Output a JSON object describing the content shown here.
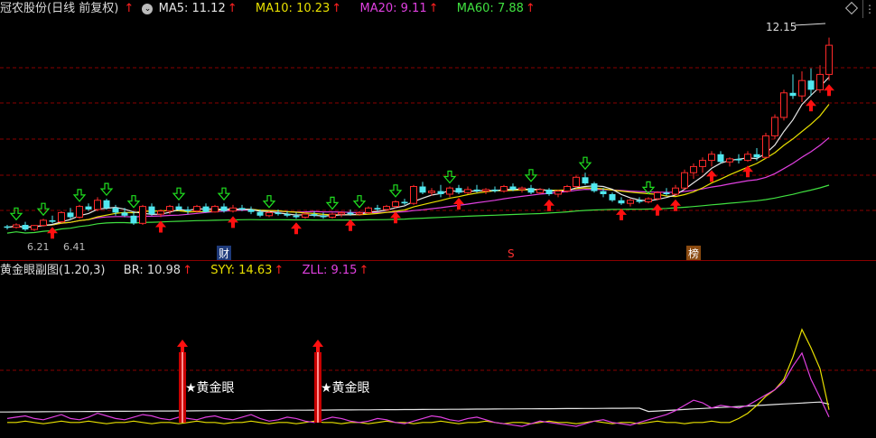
{
  "main_legend": {
    "title": "冠农股份(日线 前复权)",
    "ma5": "MA5: 11.12",
    "ma10": "MA10: 10.23",
    "ma20": "MA20: 9.11",
    "ma60": "MA60: 7.88"
  },
  "sub_legend": {
    "title": "黄金眼副图(1.20,3)",
    "br": "BR: 10.98",
    "syy": "SYY: 14.63",
    "zll": "ZLL: 9.15"
  },
  "colors": {
    "up_candle": "#ff2a2a",
    "down_candle": "#50e8f0",
    "ma5": "#e6e6e6",
    "ma10": "#e8e000",
    "ma20": "#e040e0",
    "ma60": "#40e040",
    "grid": "#8a0000",
    "buy_arrow": "#ff1010",
    "sell_arrow": "#20e020"
  },
  "chart_data": [
    {
      "type": "candlestick",
      "ylim": [
        5.8,
        12.8
      ],
      "grid": true,
      "series_names": [
        "MA5",
        "MA10",
        "MA20",
        "MA60"
      ],
      "candles": [
        [
          6.25,
          6.3,
          6.15,
          6.22
        ],
        [
          6.22,
          6.35,
          6.18,
          6.3
        ],
        [
          6.3,
          6.4,
          6.1,
          6.15
        ],
        [
          6.15,
          6.3,
          6.1,
          6.28
        ],
        [
          6.28,
          6.5,
          6.25,
          6.45
        ],
        [
          6.45,
          6.6,
          6.35,
          6.4
        ],
        [
          6.4,
          6.75,
          6.35,
          6.7
        ],
        [
          6.7,
          6.85,
          6.5,
          6.55
        ],
        [
          6.55,
          6.95,
          6.5,
          6.9
        ],
        [
          6.9,
          7.0,
          6.75,
          6.8
        ],
        [
          6.8,
          7.2,
          6.75,
          7.1
        ],
        [
          7.1,
          7.15,
          6.8,
          6.85
        ],
        [
          6.85,
          6.95,
          6.6,
          6.7
        ],
        [
          6.7,
          6.85,
          6.55,
          6.6
        ],
        [
          6.6,
          6.75,
          6.3,
          6.35
        ],
        [
          6.35,
          6.95,
          6.3,
          6.9
        ],
        [
          6.9,
          7.0,
          6.6,
          6.65
        ],
        [
          6.65,
          6.8,
          6.55,
          6.75
        ],
        [
          6.75,
          6.95,
          6.65,
          6.9
        ],
        [
          6.9,
          7.0,
          6.75,
          6.8
        ],
        [
          6.8,
          6.9,
          6.65,
          6.75
        ],
        [
          6.75,
          6.95,
          6.7,
          6.9
        ],
        [
          6.9,
          7.0,
          6.7,
          6.72
        ],
        [
          6.72,
          6.95,
          6.7,
          6.9
        ],
        [
          6.9,
          7.0,
          6.7,
          6.75
        ],
        [
          6.75,
          6.95,
          6.7,
          6.85
        ],
        [
          6.85,
          6.95,
          6.75,
          6.8
        ],
        [
          6.8,
          6.9,
          6.65,
          6.72
        ],
        [
          6.72,
          6.8,
          6.55,
          6.6
        ],
        [
          6.6,
          6.75,
          6.55,
          6.7
        ],
        [
          6.7,
          6.8,
          6.6,
          6.65
        ],
        [
          6.65,
          6.75,
          6.55,
          6.6
        ],
        [
          6.6,
          6.7,
          6.5,
          6.55
        ],
        [
          6.55,
          6.7,
          6.5,
          6.65
        ],
        [
          6.65,
          6.75,
          6.55,
          6.6
        ],
        [
          6.6,
          6.7,
          6.5,
          6.55
        ],
        [
          6.55,
          6.7,
          6.5,
          6.65
        ],
        [
          6.65,
          6.75,
          6.55,
          6.7
        ],
        [
          6.7,
          6.8,
          6.6,
          6.65
        ],
        [
          6.65,
          6.75,
          6.6,
          6.7
        ],
        [
          6.7,
          6.9,
          6.65,
          6.85
        ],
        [
          6.85,
          6.95,
          6.75,
          6.8
        ],
        [
          6.8,
          6.95,
          6.75,
          6.9
        ],
        [
          6.9,
          7.1,
          6.85,
          7.05
        ],
        [
          7.05,
          7.15,
          6.95,
          7.0
        ],
        [
          7.0,
          7.6,
          6.95,
          7.55
        ],
        [
          7.55,
          7.7,
          7.3,
          7.35
        ],
        [
          7.35,
          7.5,
          7.25,
          7.4
        ],
        [
          7.4,
          7.6,
          7.2,
          7.3
        ],
        [
          7.3,
          7.55,
          7.2,
          7.5
        ],
        [
          7.5,
          7.6,
          7.3,
          7.35
        ],
        [
          7.35,
          7.55,
          7.3,
          7.45
        ],
        [
          7.45,
          7.6,
          7.35,
          7.4
        ],
        [
          7.4,
          7.5,
          7.3,
          7.45
        ],
        [
          7.45,
          7.55,
          7.35,
          7.4
        ],
        [
          7.4,
          7.6,
          7.35,
          7.55
        ],
        [
          7.55,
          7.65,
          7.4,
          7.45
        ],
        [
          7.45,
          7.55,
          7.35,
          7.5
        ],
        [
          7.5,
          7.6,
          7.3,
          7.35
        ],
        [
          7.35,
          7.5,
          7.3,
          7.45
        ],
        [
          7.45,
          7.5,
          7.25,
          7.3
        ],
        [
          7.3,
          7.45,
          7.2,
          7.4
        ],
        [
          7.4,
          7.6,
          7.35,
          7.55
        ],
        [
          7.55,
          7.9,
          7.5,
          7.85
        ],
        [
          7.85,
          8.0,
          7.6,
          7.65
        ],
        [
          7.65,
          7.7,
          7.35,
          7.4
        ],
        [
          7.4,
          7.5,
          7.2,
          7.3
        ],
        [
          7.3,
          7.35,
          7.05,
          7.1
        ],
        [
          7.1,
          7.2,
          6.95,
          7.0
        ],
        [
          7.0,
          7.15,
          6.9,
          7.1
        ],
        [
          7.1,
          7.2,
          7.0,
          7.05
        ],
        [
          7.05,
          7.2,
          7.0,
          7.15
        ],
        [
          7.15,
          7.4,
          7.1,
          7.35
        ],
        [
          7.35,
          7.5,
          7.25,
          7.3
        ],
        [
          7.3,
          7.6,
          7.25,
          7.5
        ],
        [
          7.5,
          8.1,
          7.45,
          8.0
        ],
        [
          8.0,
          8.3,
          7.8,
          8.2
        ],
        [
          8.2,
          8.5,
          8.0,
          8.4
        ],
        [
          8.4,
          8.7,
          8.2,
          8.6
        ],
        [
          8.6,
          8.7,
          8.3,
          8.35
        ],
        [
          8.35,
          8.5,
          8.2,
          8.45
        ],
        [
          8.45,
          8.6,
          8.3,
          8.4
        ],
        [
          8.4,
          8.7,
          8.35,
          8.6
        ],
        [
          8.6,
          8.8,
          8.4,
          8.5
        ],
        [
          8.5,
          9.3,
          8.45,
          9.2
        ],
        [
          9.2,
          9.9,
          9.1,
          9.8
        ],
        [
          9.8,
          10.7,
          9.7,
          10.6
        ],
        [
          10.6,
          11.2,
          10.4,
          10.5
        ],
        [
          10.5,
          11.3,
          10.3,
          11.0
        ],
        [
          11.0,
          11.4,
          10.5,
          10.7
        ],
        [
          10.7,
          11.5,
          10.6,
          11.2
        ],
        [
          11.2,
          12.4,
          11.0,
          12.15
        ]
      ],
      "ma5_last": 11.12,
      "ma10_last": 10.23,
      "ma20_last": 9.11,
      "ma60_last": 7.88,
      "annotations": [
        {
          "label": "12.15",
          "bar": 91
        },
        {
          "label": "6.21",
          "bar": 2
        },
        {
          "label": "6.41",
          "bar": 6
        },
        {
          "label": "财",
          "bar": 24
        },
        {
          "label": "S",
          "bar": 56
        },
        {
          "label": "榜",
          "bar": 76
        }
      ],
      "buy_signals": [
        5,
        17,
        25,
        32,
        38,
        43,
        50,
        60,
        68,
        72,
        74,
        78,
        82,
        89,
        91
      ],
      "sell_signals": [
        1,
        4,
        8,
        11,
        14,
        19,
        24,
        29,
        36,
        39,
        43,
        49,
        58,
        64,
        71
      ]
    },
    {
      "type": "line",
      "ylim": [
        0,
        100
      ],
      "series_names": [
        "BR",
        "SYY",
        "ZLL"
      ],
      "BR": [
        13,
        13,
        13,
        13,
        13,
        13,
        13,
        13,
        13,
        13,
        13,
        13,
        13,
        13,
        13,
        13,
        13,
        13,
        13,
        13,
        13,
        13,
        13,
        13,
        13,
        13,
        13,
        13,
        13,
        13,
        13,
        13,
        13,
        13,
        13,
        13,
        13,
        13,
        13,
        13,
        13,
        13,
        13,
        13,
        13,
        13,
        13,
        13,
        13,
        13,
        13,
        13,
        13,
        13,
        13,
        13,
        13,
        13,
        13,
        13,
        13,
        13,
        13,
        13,
        13,
        13,
        13,
        13,
        13,
        13,
        13,
        13,
        13,
        13,
        13,
        13,
        13,
        13,
        13,
        13,
        13,
        13,
        13,
        13,
        13,
        13,
        13,
        13,
        13,
        13,
        13,
        10.98
      ],
      "SYY": [
        5,
        5,
        6,
        5,
        4,
        5,
        6,
        5,
        5,
        6,
        5,
        4,
        5,
        5,
        6,
        5,
        4,
        5,
        5,
        4,
        5,
        6,
        5,
        5,
        4,
        5,
        5,
        6,
        5,
        4,
        5,
        5,
        4,
        5,
        6,
        5,
        5,
        4,
        5,
        5,
        4,
        5,
        6,
        5,
        5,
        4,
        5,
        5,
        6,
        5,
        4,
        5,
        5,
        6,
        5,
        4,
        5,
        5,
        4,
        5,
        6,
        5,
        5,
        4,
        5,
        6,
        5,
        4,
        5,
        5,
        4,
        5,
        6,
        5,
        5,
        4,
        5,
        5,
        6,
        5,
        5,
        8,
        12,
        18,
        25,
        30,
        38,
        55,
        76,
        62,
        46,
        14.63
      ],
      "ZLL": [
        8,
        9,
        10,
        8,
        7,
        9,
        11,
        8,
        7,
        9,
        12,
        10,
        8,
        7,
        9,
        11,
        10,
        8,
        7,
        9,
        8,
        7,
        9,
        10,
        8,
        7,
        9,
        11,
        8,
        6,
        7,
        9,
        8,
        6,
        5,
        7,
        9,
        8,
        6,
        5,
        6,
        8,
        7,
        5,
        4,
        6,
        8,
        10,
        9,
        7,
        6,
        8,
        9,
        7,
        5,
        4,
        3,
        2,
        4,
        6,
        5,
        4,
        3,
        2,
        4,
        6,
        7,
        5,
        4,
        3,
        5,
        7,
        9,
        11,
        14,
        18,
        22,
        20,
        16,
        18,
        17,
        16,
        18,
        22,
        26,
        30,
        36,
        48,
        58,
        38,
        24,
        9.15
      ]
    }
  ],
  "sub_annotations": [
    {
      "label": "★黄金眼",
      "bar": 19
    },
    {
      "label": "★黄金眼",
      "bar": 34
    }
  ]
}
